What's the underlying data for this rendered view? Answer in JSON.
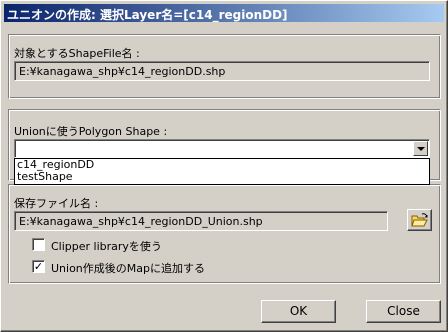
{
  "window": {
    "title": "ユニオンの作成: 選択Layer名=[c14_regionDD]"
  },
  "target_group": {
    "label": "対象とするShapeFile名 :",
    "path": "E:¥kanagawa_shp¥c14_regionDD.shp"
  },
  "union_group": {
    "label": "Unionに使うPolygon Shape :",
    "selected_value": "",
    "options": [
      "c14_regionDD",
      "testShape"
    ]
  },
  "save_group": {
    "label": "保存ファイル名 :",
    "path": "E:¥kanagawa_shp¥c14_regionDD_Union.shp",
    "clipper_label": "Clipper libraryを使う",
    "clipper_checked": false,
    "add_to_map_label": "Union作成後のMapに追加する",
    "add_to_map_checked": true
  },
  "buttons": {
    "ok": "OK",
    "close": "Close"
  },
  "icons": {
    "browse": "open-folder-icon",
    "dropdown": "chevron-down-icon"
  }
}
